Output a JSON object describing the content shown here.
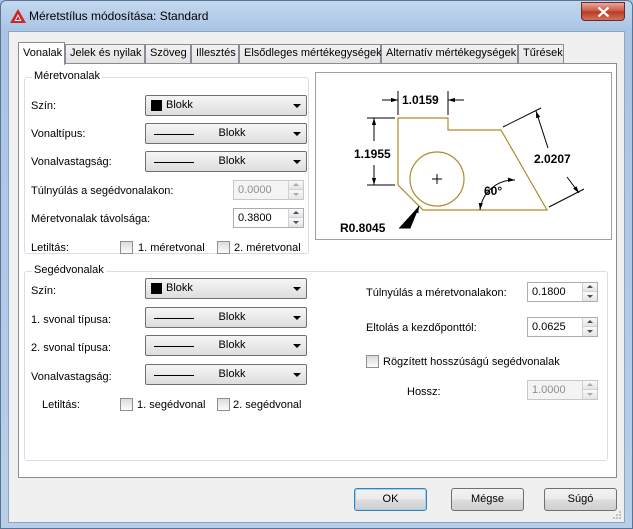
{
  "window": {
    "title": "Méretstílus módosítása: Standard"
  },
  "tabs": [
    {
      "label": "Vonalak",
      "active": true
    },
    {
      "label": "Jelek és nyilak"
    },
    {
      "label": "Szöveg"
    },
    {
      "label": "Illesztés"
    },
    {
      "label": "Elsődleges mértékegységek"
    },
    {
      "label": "Alternatív mértékegységek"
    },
    {
      "label": "Tűrések"
    }
  ],
  "dimlines": {
    "title": "Méretvonalak",
    "color_label": "Szín:",
    "color_value": "Blokk",
    "linetype_label": "Vonaltípus:",
    "linetype_value": "Blokk",
    "lineweight_label": "Vonalvastagság:",
    "lineweight_value": "Blokk",
    "extend_label": "Túlnyúlás a segédvonalakon:",
    "extend_value": "0.0000",
    "baseline_label": "Méretvonalak távolsága:",
    "baseline_value": "0.3800",
    "suppress_label": "Letiltás:",
    "suppress_1": "1. méretvonal",
    "suppress_2": "2. méretvonal"
  },
  "extlines": {
    "title": "Segédvonalak",
    "color_label": "Szín:",
    "color_value": "Blokk",
    "linetype1_label": "1. svonal típusa:",
    "linetype1_value": "Blokk",
    "linetype2_label": "2. svonal típusa:",
    "linetype2_value": "Blokk",
    "lineweight_label": "Vonalvastagság:",
    "lineweight_value": "Blokk",
    "suppress_label": "Letiltás:",
    "suppress_1": "1. segédvonal",
    "suppress_2": "2. segédvonal",
    "extend_label": "Túlnyúlás a méretvonalakon:",
    "extend_value": "0.1800",
    "offset_label": "Eltolás a kezdőponttól:",
    "offset_value": "0.0625",
    "fixed_label": "Rögzített hosszúságú segédvonalak",
    "length_label": "Hossz:",
    "length_value": "1.0000"
  },
  "preview": {
    "dim_top": "1.0159",
    "dim_left": "1.1955",
    "dim_right": "2.0207",
    "angle": "60°",
    "radius": "R0.8045"
  },
  "buttons": {
    "ok": "OK",
    "cancel": "Mégse",
    "help": "Súgó"
  },
  "colors": {
    "outline": "#b08a2a",
    "accent": "#3c7fb1"
  }
}
